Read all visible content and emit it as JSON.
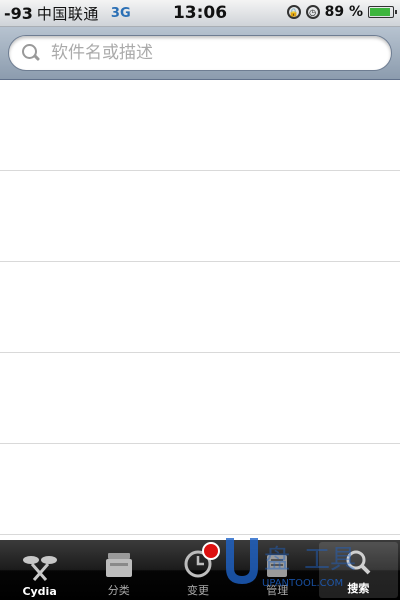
{
  "status_bar": {
    "signal": "-93",
    "carrier": "中国联通",
    "network": "3G",
    "time": "13:06",
    "battery_percent": "89 %",
    "battery_level": 0.89
  },
  "search": {
    "placeholder": "软件名或描述",
    "value": ""
  },
  "results": [
    "",
    "",
    "",
    "",
    ""
  ],
  "tabs": [
    {
      "label": "Cydia",
      "icon": "cydia-icon",
      "active": false
    },
    {
      "label": "分类",
      "icon": "sections-icon",
      "active": false
    },
    {
      "label": "变更",
      "icon": "clock-icon",
      "active": false
    },
    {
      "label": "管理",
      "icon": "manage-icon",
      "active": false
    },
    {
      "label": "搜索",
      "icon": "search-icon",
      "active": true
    }
  ],
  "watermark": {
    "brand": "UPANTOOL.COM",
    "url_fragment": "http://"
  },
  "colors": {
    "network_label": "#2a6fb5",
    "battery_fill": "#3db53d",
    "badge": "#dd1111",
    "watermark": "#1e63c8"
  }
}
